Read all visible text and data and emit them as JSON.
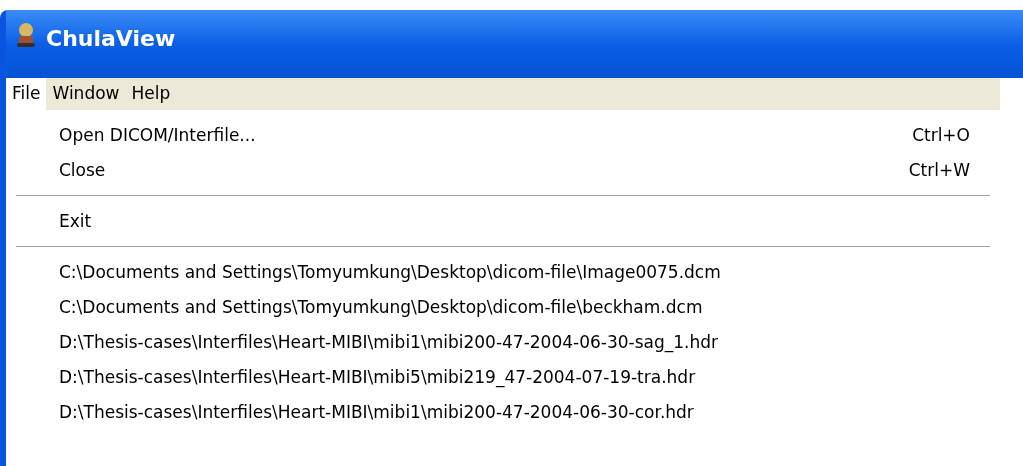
{
  "window": {
    "title": "ChulaView"
  },
  "menu_bar": [
    {
      "label": "File",
      "selected": true
    },
    {
      "label": "Window",
      "selected": false
    },
    {
      "label": "Help",
      "selected": false
    }
  ],
  "file_menu": [
    {
      "kind": "item",
      "label": "Open DICOM/Interfile...",
      "shortcut": "Ctrl+O"
    },
    {
      "kind": "item",
      "label": "Close",
      "shortcut": "Ctrl+W"
    },
    {
      "kind": "separator"
    },
    {
      "kind": "item",
      "label": "Exit"
    },
    {
      "kind": "separator"
    },
    {
      "kind": "item",
      "label": "C:\\Documents and Settings\\Tomyumkung\\Desktop\\dicom-file\\Image0075.dcm"
    },
    {
      "kind": "item",
      "label": "C:\\Documents and Settings\\Tomyumkung\\Desktop\\dicom-file\\beckham.dcm"
    },
    {
      "kind": "item",
      "label": "D:\\Thesis-cases\\Interfiles\\Heart-MIBI\\mibi1\\mibi200-47-2004-06-30-sag_1.hdr"
    },
    {
      "kind": "item",
      "label": "D:\\Thesis-cases\\Interfiles\\Heart-MIBI\\mibi5\\mibi219_47-2004-07-19-tra.hdr"
    },
    {
      "kind": "item",
      "label": "D:\\Thesis-cases\\Interfiles\\Heart-MIBI\\mibi1\\mibi200-47-2004-06-30-cor.hdr"
    }
  ]
}
